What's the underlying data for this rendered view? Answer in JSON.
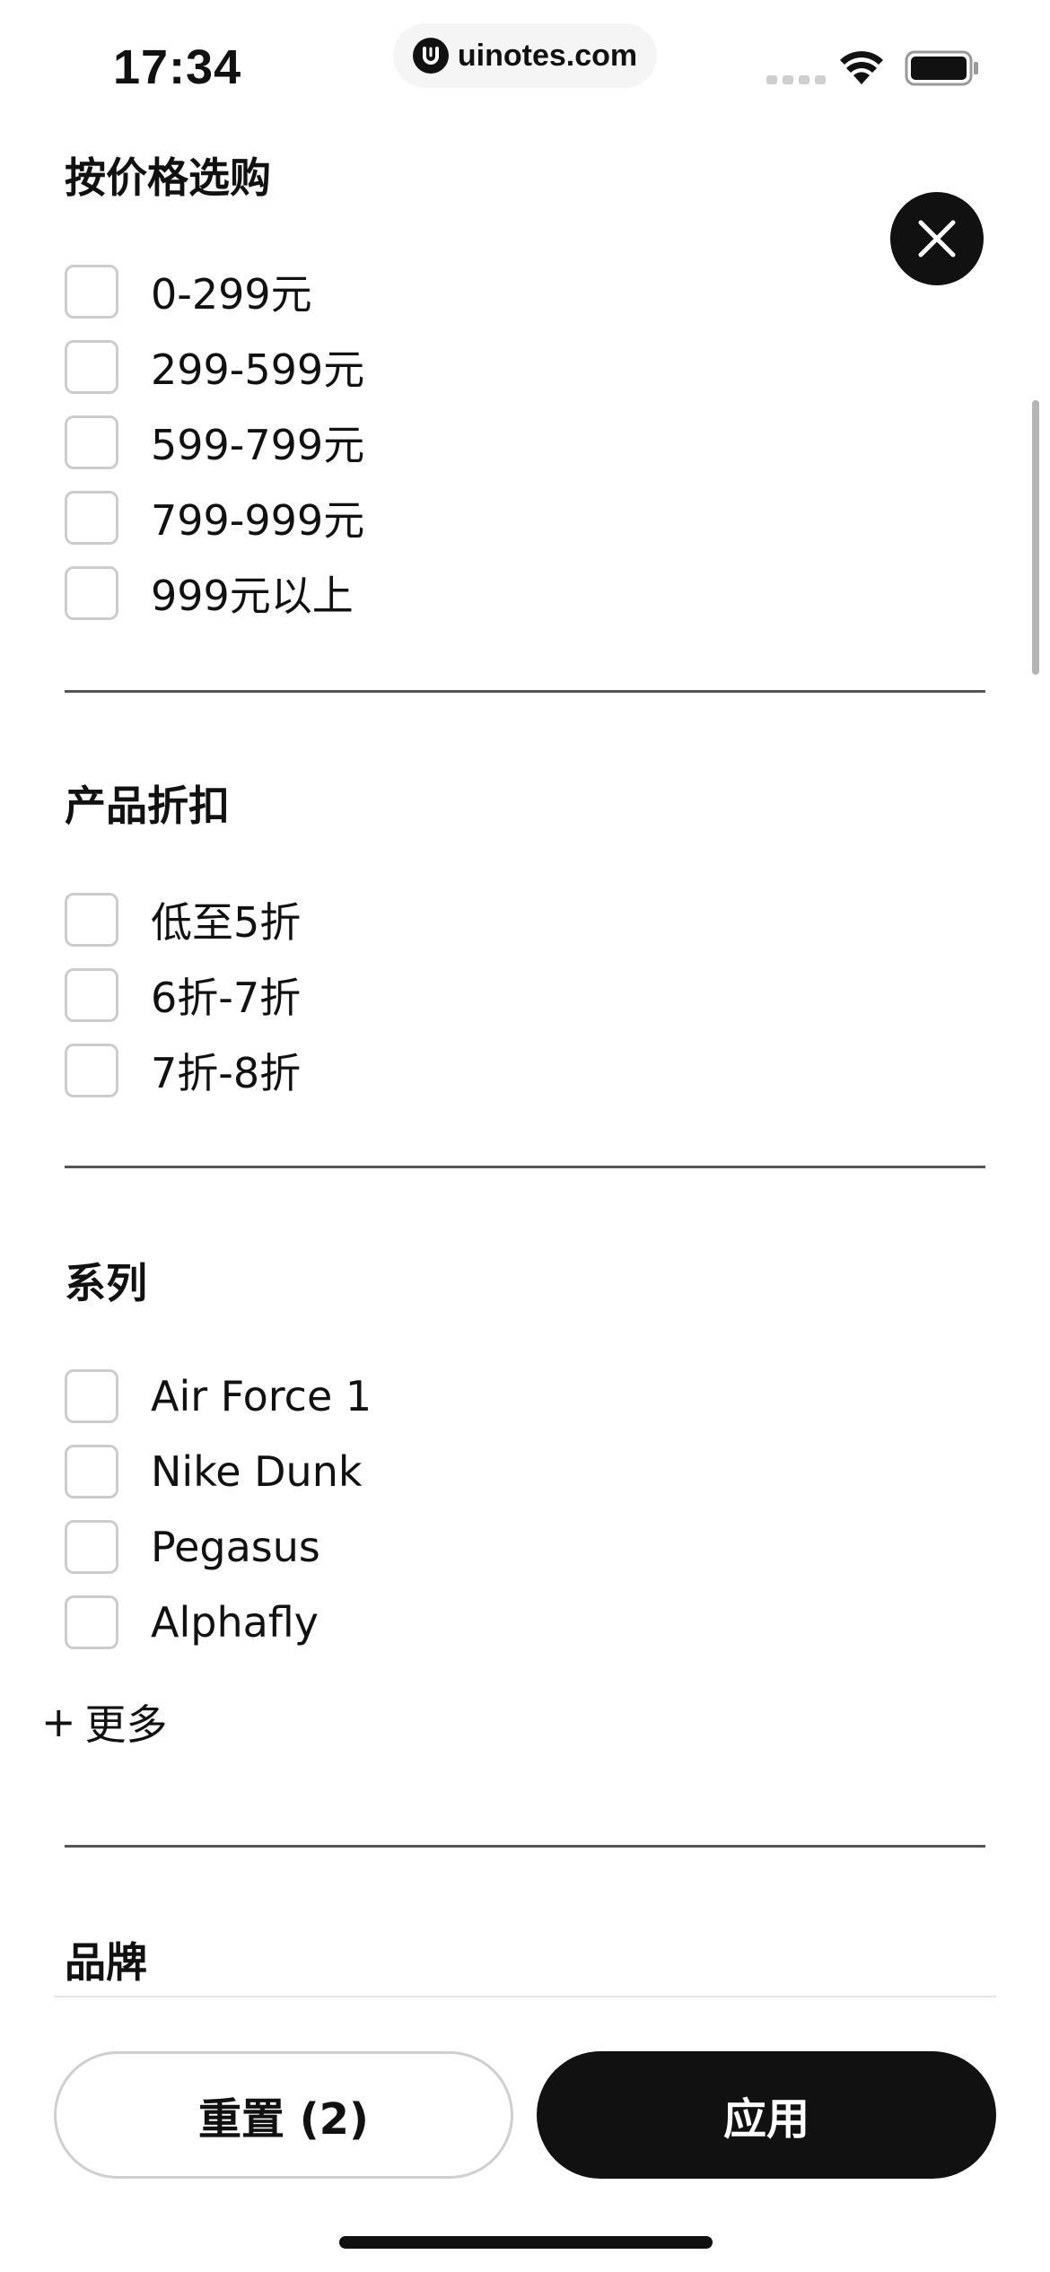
{
  "status_bar": {
    "time": "17:34",
    "url": "uinotes.com",
    "icons": [
      "cellular-signal-icon",
      "wifi-icon",
      "battery-icon"
    ]
  },
  "close_icon": "close-icon",
  "sections": {
    "price": {
      "title": "按价格选购",
      "options": [
        "0-299元",
        "299-599元",
        "599-799元",
        "799-999元",
        "999元以上"
      ]
    },
    "discount": {
      "title": "产品折扣",
      "options": [
        "低至5折",
        "6折-7折",
        "7折-8折"
      ]
    },
    "series": {
      "title": "系列",
      "options": [
        "Air Force 1",
        "Nike Dunk",
        "Pegasus",
        "Alphafly"
      ],
      "more_label": "更多"
    },
    "brand": {
      "title": "品牌"
    }
  },
  "footer": {
    "reset_label": "重置 (2)",
    "apply_label": "应用"
  },
  "colors": {
    "primary": "#111111",
    "checkbox_border": "#cccccc",
    "divider": "#555555",
    "background": "#ffffff"
  }
}
